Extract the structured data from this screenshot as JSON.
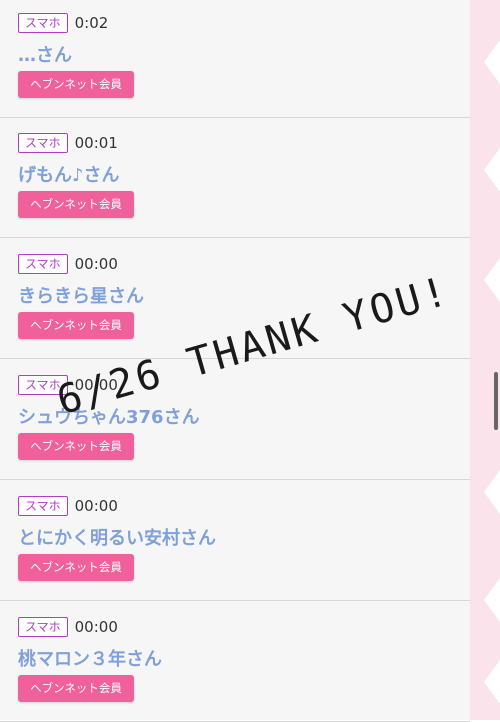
{
  "entries": [
    {
      "device": "スマホ",
      "time": "0:02",
      "name": "…さん",
      "member_label": "ヘブンネット会員"
    },
    {
      "device": "スマホ",
      "time": "00:01",
      "name": "げもん♪さん",
      "member_label": "ヘブンネット会員"
    },
    {
      "device": "スマホ",
      "time": "00:00",
      "name": "きらきら星さん",
      "member_label": "ヘブンネット会員"
    },
    {
      "device": "スマホ",
      "time": "00:00",
      "name": "シュウちゃん376さん",
      "member_label": "ヘブンネット会員"
    },
    {
      "device": "スマホ",
      "time": "00:00",
      "name": "とにかく明るい安村さん",
      "member_label": "ヘブンネット会員"
    },
    {
      "device": "スマホ",
      "time": "00:00",
      "name": "桃マロン３年さん",
      "member_label": "ヘブンネット会員"
    }
  ],
  "overlay": {
    "text": "6/26 THANK YOU!"
  },
  "colors": {
    "device_badge": "#b23bc8",
    "visitor_name": "#7fa0d8",
    "member_button": "#f0609a",
    "side_decoration": "#fbe3ec"
  }
}
